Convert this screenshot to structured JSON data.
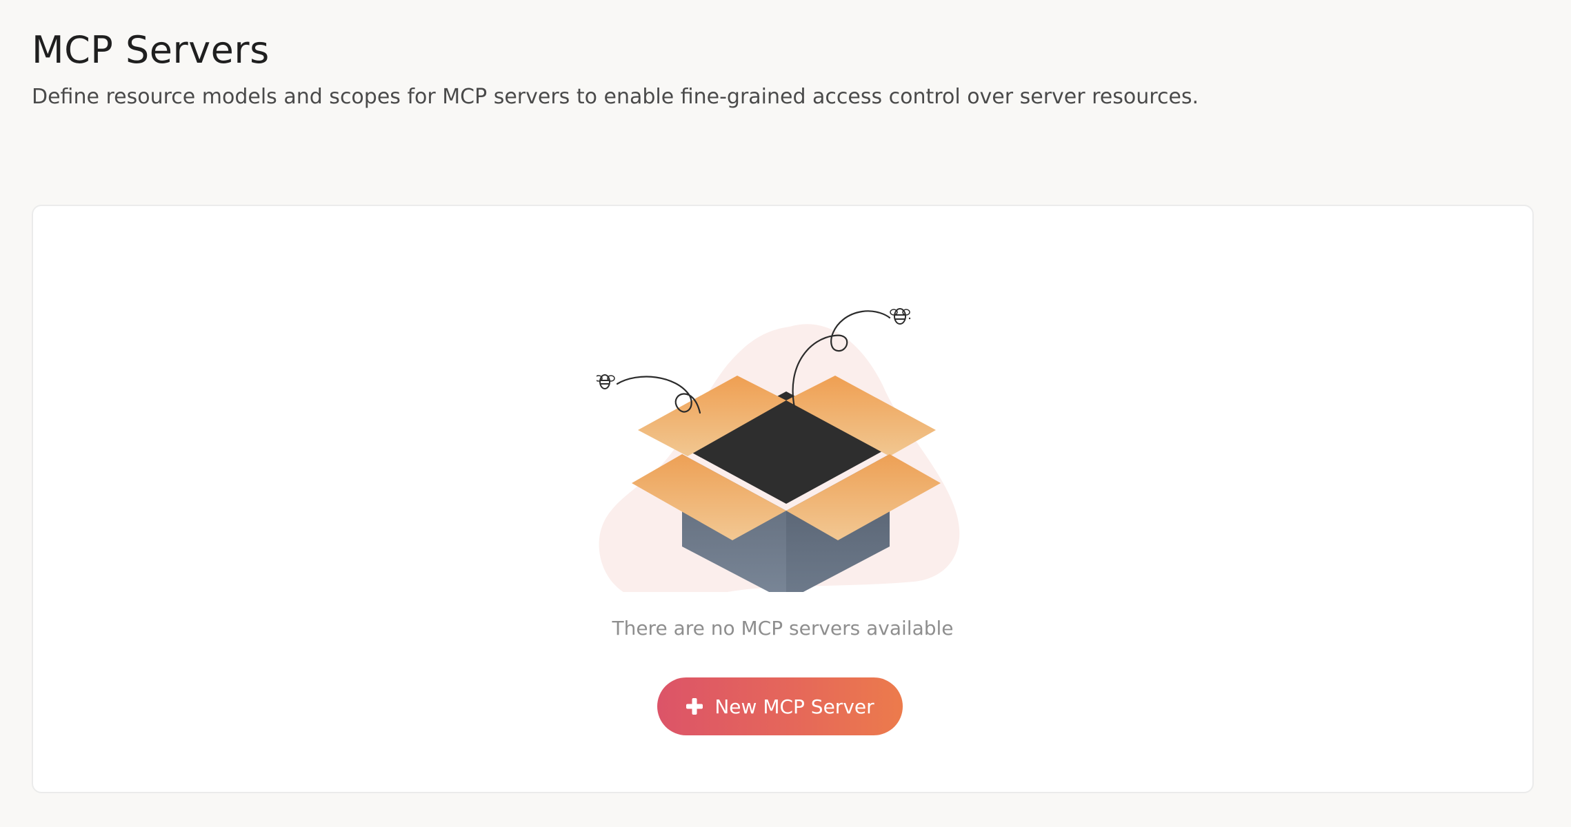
{
  "header": {
    "title": "MCP Servers",
    "subtitle": "Define resource models and scopes for MCP servers to enable fine-grained access control over server resources."
  },
  "empty_state": {
    "illustration_icon": "open-box-with-bees-icon",
    "message": "There are no MCP servers available",
    "button_icon": "plus-icon",
    "button_label": "New MCP Server"
  },
  "colors": {
    "page_background": "#f9f8f6",
    "card_background": "#ffffff",
    "button_gradient_start": "#dc5468",
    "button_gradient_end": "#ec7b4c",
    "box_flap": "#eda45f",
    "box_body": "#6b7685",
    "box_inside": "#2e2e2e",
    "blob": "#fbeeec"
  }
}
